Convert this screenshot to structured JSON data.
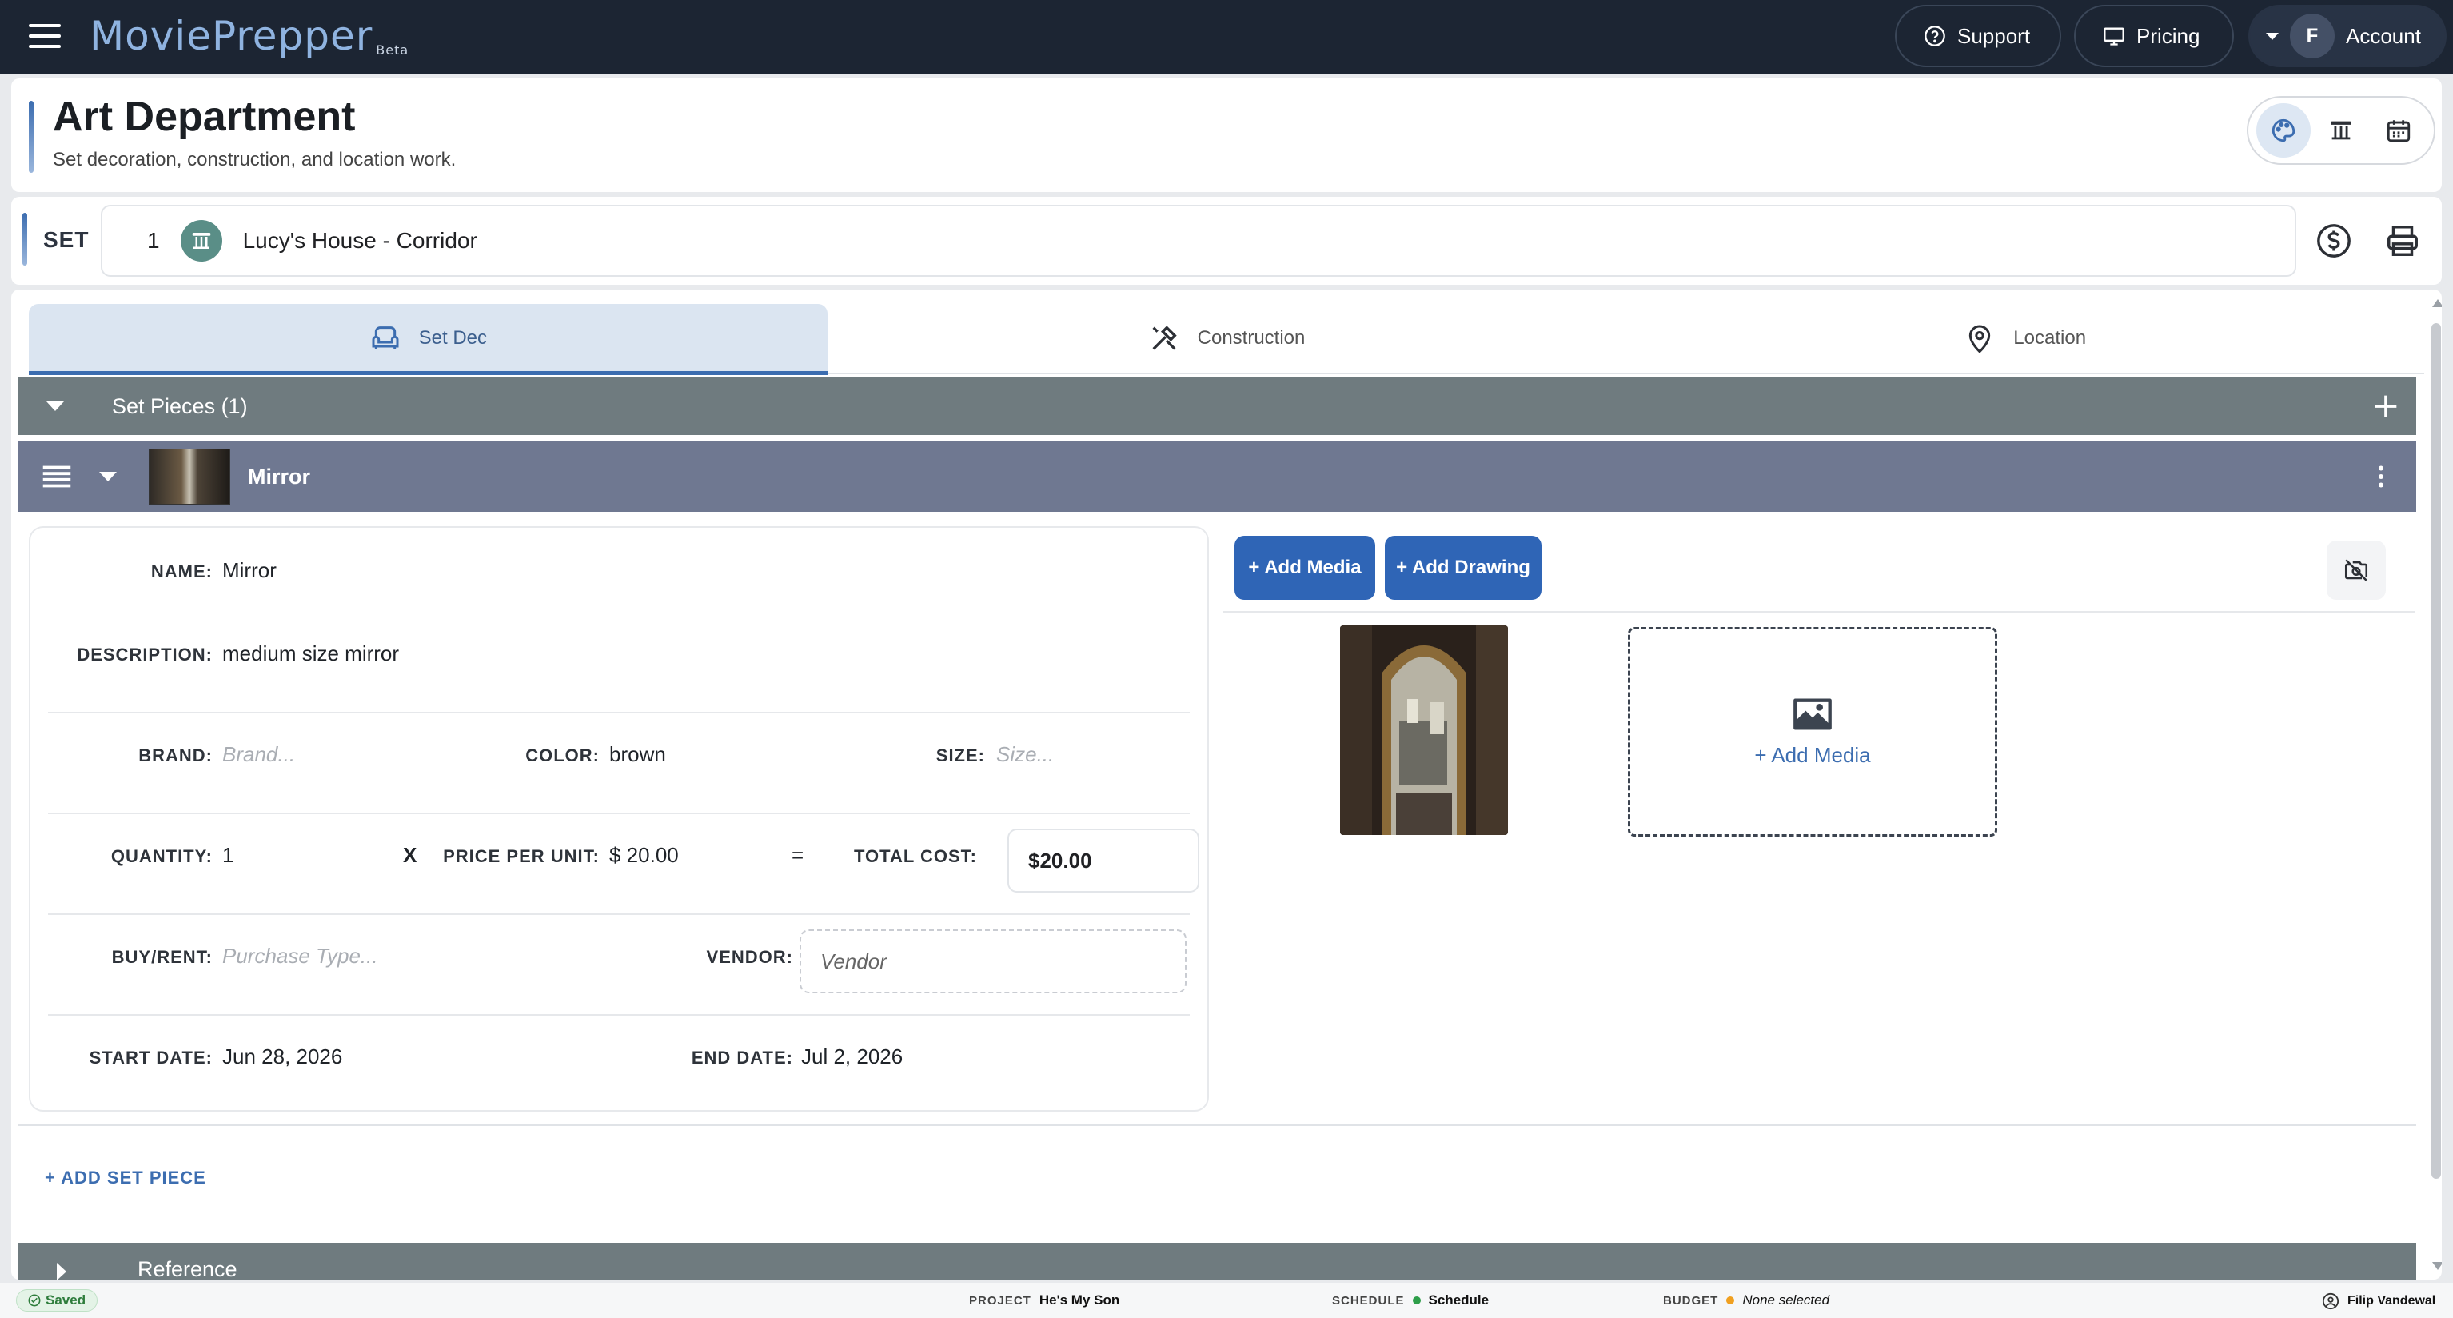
{
  "app": {
    "logo_text": "MoviePrepper",
    "logo_badge": "Beta"
  },
  "topbar": {
    "support_label": "Support",
    "pricing_label": "Pricing",
    "account_label": "Account",
    "account_initial": "F"
  },
  "header": {
    "title": "Art Department",
    "subtitle": "Set decoration, construction, and location work."
  },
  "set": {
    "label": "SET",
    "number": "1",
    "name": "Lucy's House - Corridor"
  },
  "tabs": [
    {
      "label": "Set Dec",
      "active": true
    },
    {
      "label": "Construction",
      "active": false
    },
    {
      "label": "Location",
      "active": false
    }
  ],
  "section": {
    "title": "Set Pieces (1)"
  },
  "item": {
    "title": "Mirror"
  },
  "form": {
    "name_label": "NAME:",
    "name_value": "Mirror",
    "description_label": "DESCRIPTION:",
    "description_value": "medium size mirror",
    "brand_label": "BRAND:",
    "brand_placeholder": "Brand...",
    "color_label": "COLOR:",
    "color_value": "brown",
    "size_label": "SIZE:",
    "size_placeholder": "Size...",
    "quantity_label": "QUANTITY:",
    "quantity_value": "1",
    "times_symbol": "X",
    "price_label": "PRICE PER UNIT:",
    "price_value": "$ 20.00",
    "equals_symbol": "=",
    "total_label": "TOTAL COST:",
    "total_value": "$20.00",
    "buyrent_label": "BUY/RENT:",
    "buyrent_placeholder": "Purchase Type...",
    "vendor_label": "VENDOR:",
    "vendor_placeholder": "Vendor",
    "start_label": "START DATE:",
    "start_value": "Jun 28, 2026",
    "end_label": "END DATE:",
    "end_value": "Jul 2, 2026"
  },
  "media": {
    "add_media_button": "+ Add Media",
    "add_drawing_button": "+ Add Drawing",
    "add_media_tile": "+ Add Media"
  },
  "add_set_piece": "+ ADD SET PIECE",
  "reference": {
    "title": "Reference"
  },
  "footer": {
    "saved": "Saved",
    "project_label": "PROJECT",
    "project_value": "He's My Son",
    "schedule_label": "SCHEDULE",
    "schedule_value": "Schedule",
    "budget_label": "BUDGET",
    "budget_value": "None selected",
    "user_name": "Filip Vandewal"
  },
  "colors": {
    "topbar": "#1c2533",
    "accent": "#3c6db0",
    "section_bar": "#6f7b7f",
    "item_bar": "#6f7891",
    "schedule_dot": "#2e9e4a",
    "budget_dot": "#f0a020"
  }
}
